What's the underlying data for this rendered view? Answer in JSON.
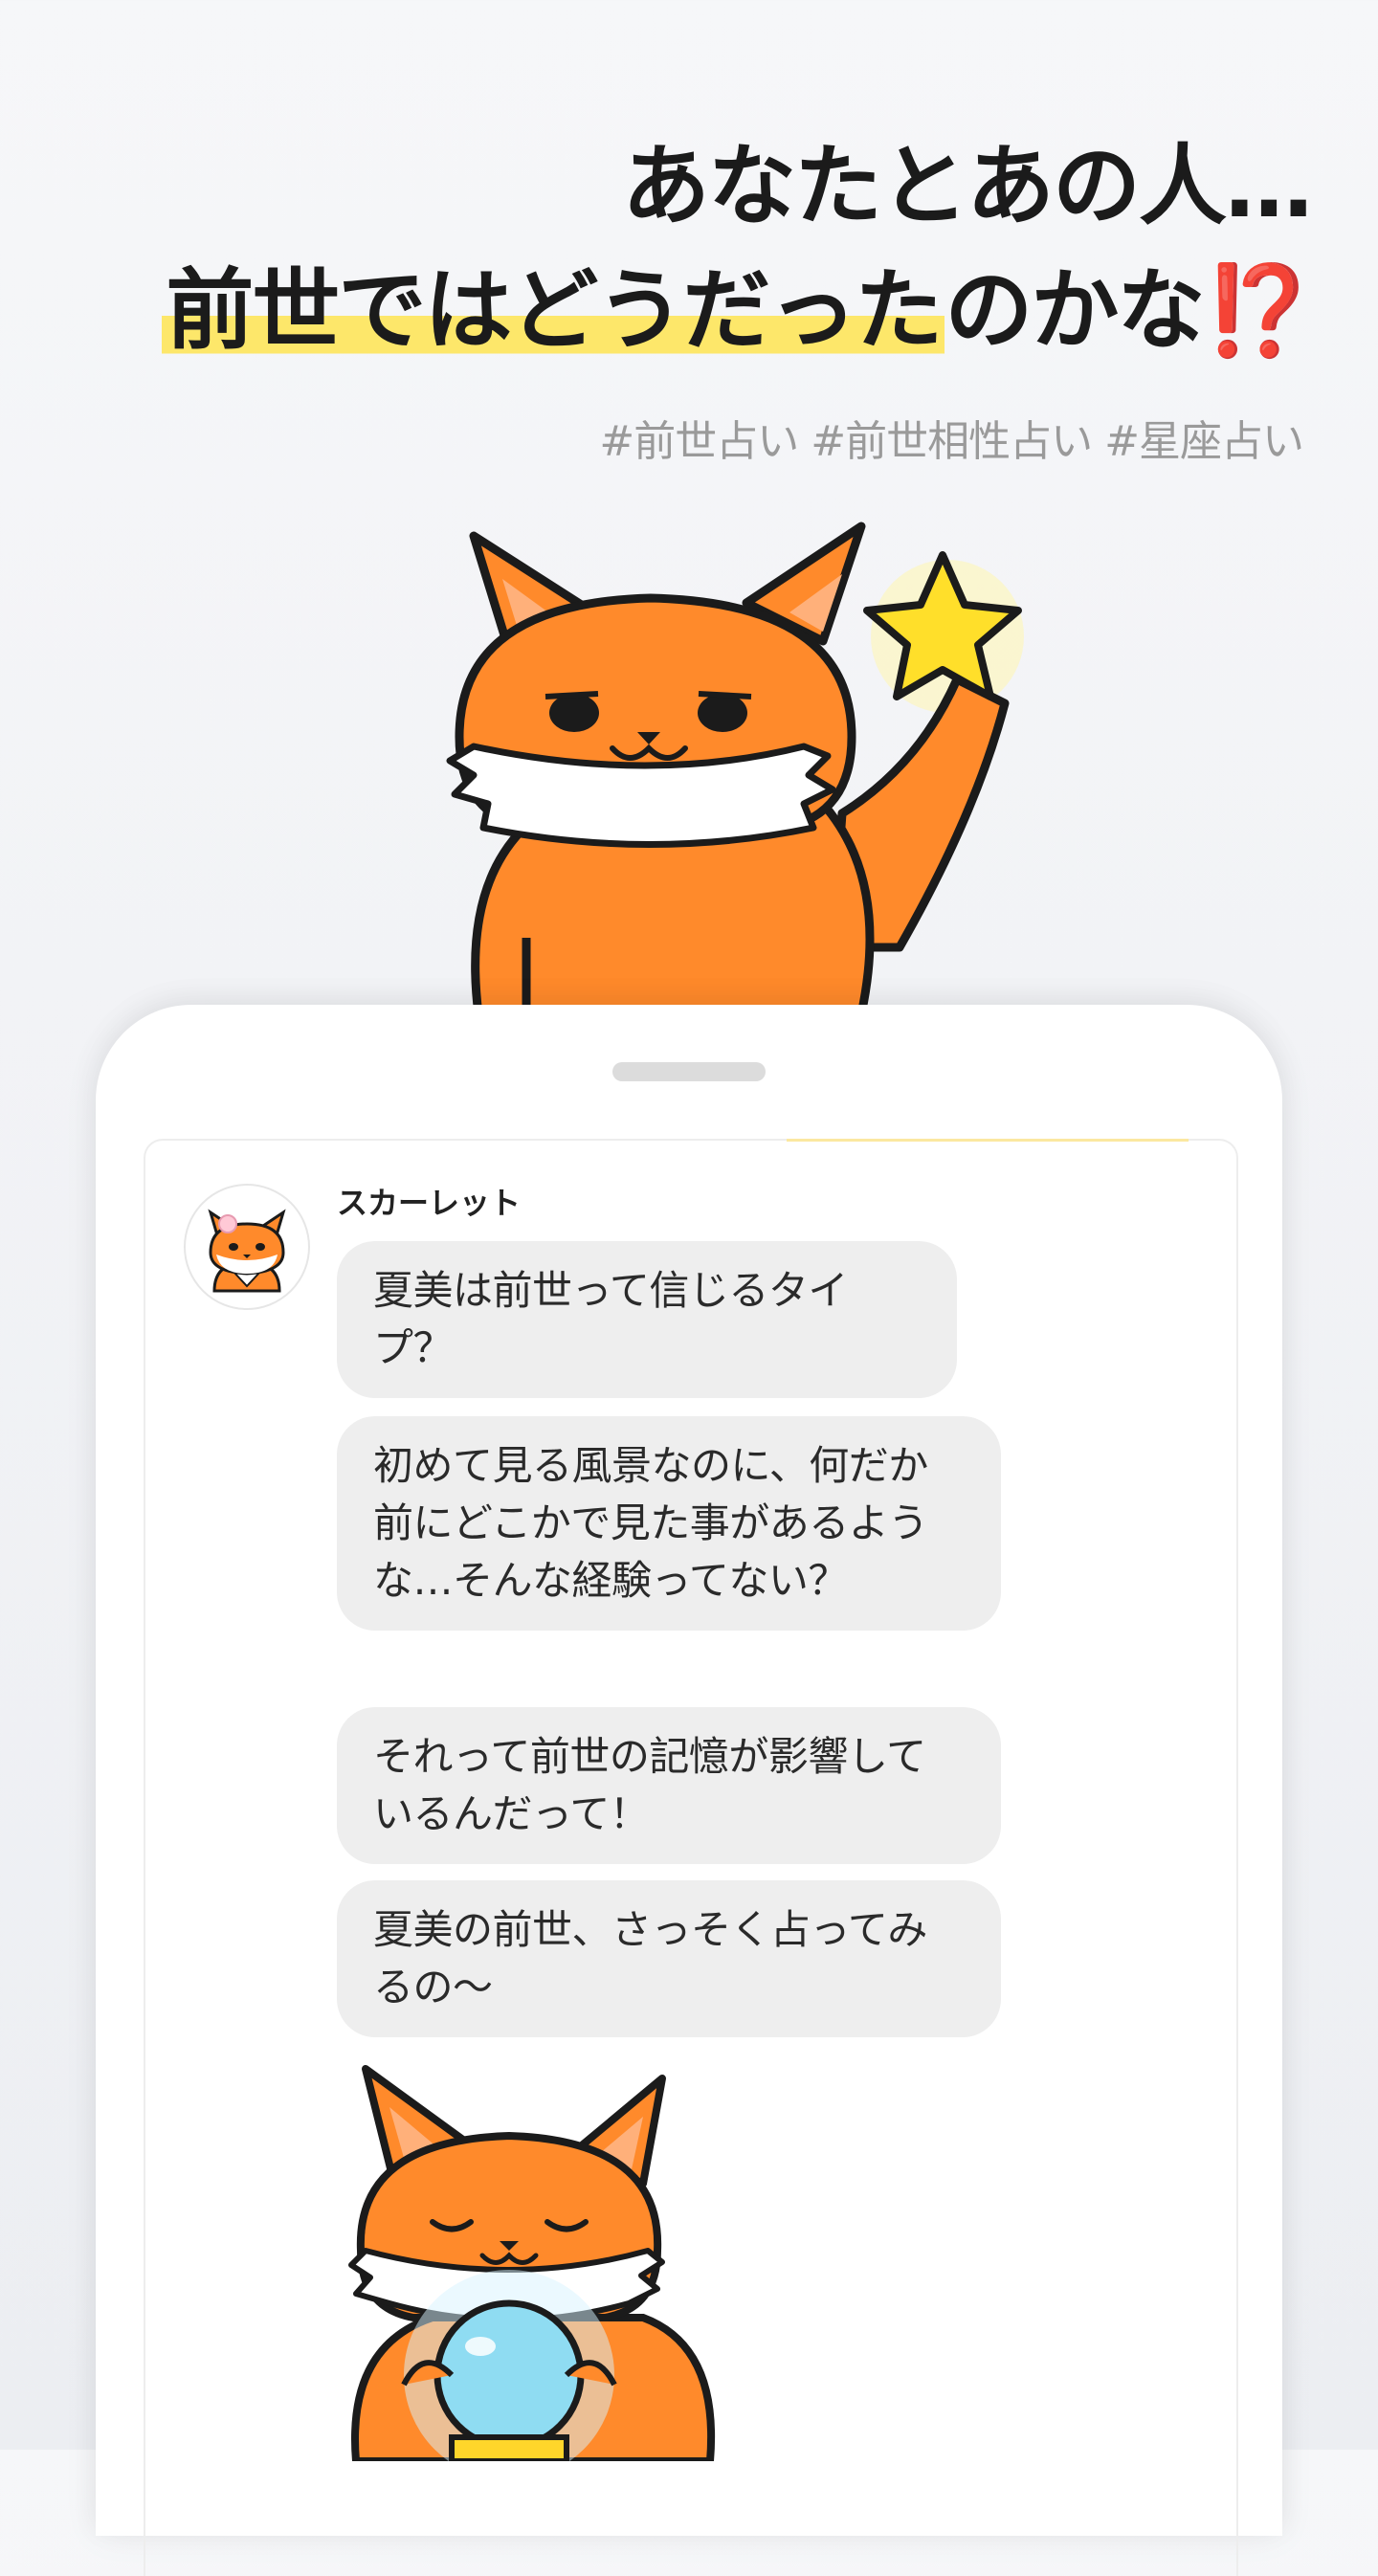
{
  "headline": {
    "line1": "あなたとあの人…",
    "line2_highlight": "前世ではどうだった",
    "line2_rest": "のかな",
    "line2_mark": "⁉️"
  },
  "hashtags": "#前世占い #前世相性占い #星座占い",
  "chat": {
    "sender": "スカーレット",
    "messages": [
      "夏美は前世って信じるタイプ？",
      "初めて見る風景なのに、何だか前にどこかで見た事があるような…そんな経験ってない？",
      "それって前世の記憶が影響しているんだって！",
      "夏美の前世、さっそく占ってみるの〜"
    ]
  },
  "colors": {
    "highlight": "#fde76a",
    "fox_orange": "#ff8a2b",
    "star": "#ffdf2a",
    "exclaim": "#e8321c"
  }
}
